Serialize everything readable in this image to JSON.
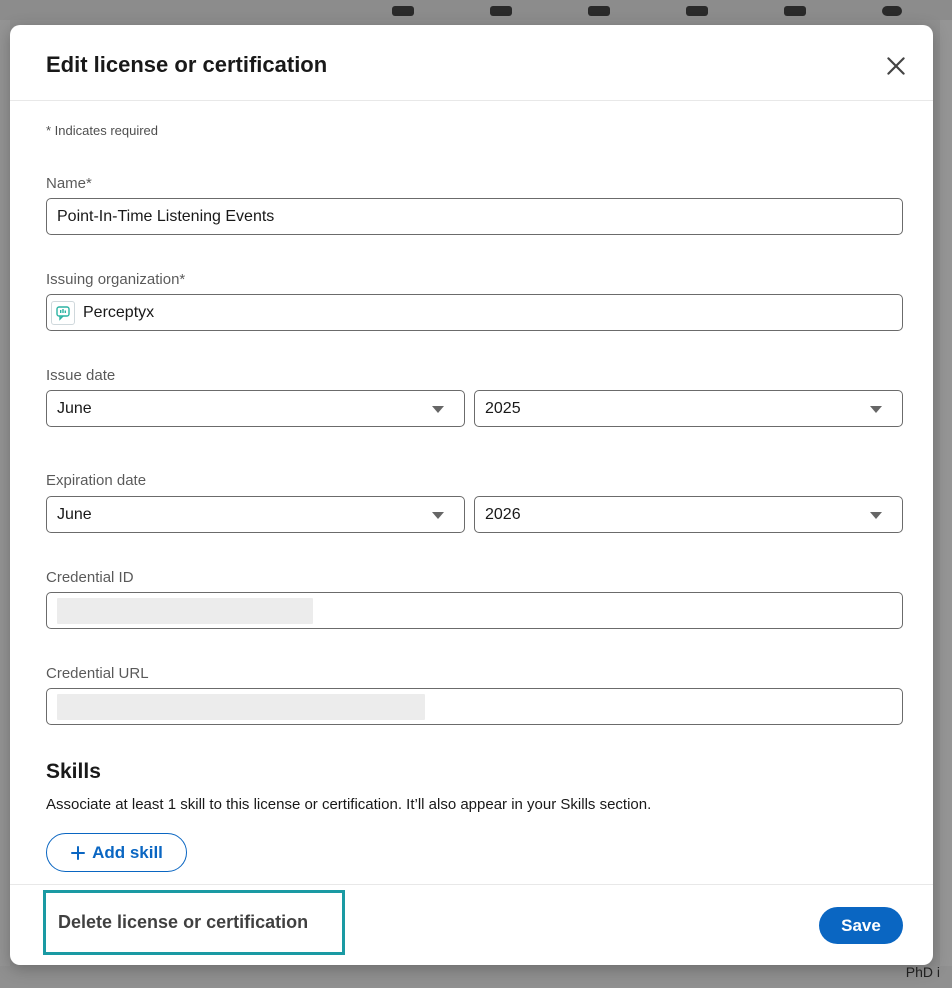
{
  "modal": {
    "title": "Edit license or certification",
    "required_note": "* Indicates required"
  },
  "form": {
    "name": {
      "label": "Name*",
      "value": "Point-In-Time Listening Events"
    },
    "organization": {
      "label": "Issuing organization*",
      "value": "Perceptyx",
      "logo_icon": "perceptyx-logo-icon"
    },
    "issue_date": {
      "label": "Issue date",
      "month": "June",
      "year": "2025"
    },
    "expiration_date": {
      "label": "Expiration date",
      "month": "June",
      "year": "2026"
    },
    "credential_id": {
      "label": "Credential ID",
      "value": ""
    },
    "credential_url": {
      "label": "Credential URL",
      "value": ""
    }
  },
  "skills": {
    "title": "Skills",
    "description": "Associate at least 1 skill to this license or certification. It’ll also appear in your Skills section.",
    "add_label": "Add skill"
  },
  "footer": {
    "delete_label": "Delete license or certification",
    "save_label": "Save"
  },
  "background": {
    "bottom_right_text": "PhD i"
  },
  "colors": {
    "accent": "#0a66c2",
    "highlight": "#1a9aa3"
  }
}
